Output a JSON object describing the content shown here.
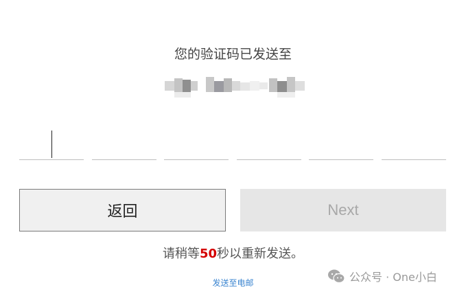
{
  "verification": {
    "title": "您的验证码已发送至",
    "code_digits": [
      "",
      "",
      "",
      "",
      "",
      ""
    ]
  },
  "buttons": {
    "back_label": "返回",
    "next_label": "Next"
  },
  "resend": {
    "prefix": "请稍等",
    "seconds": "50",
    "suffix": "秒以重新发送。",
    "send_to_phone_link": "发送至电邮"
  },
  "watermark": {
    "text": "公众号 · One小白",
    "icon": "wechat-icon"
  },
  "colors": {
    "countdown": "#d40000",
    "link": "#3a84d0",
    "next_disabled_bg": "#e6e6e6"
  }
}
